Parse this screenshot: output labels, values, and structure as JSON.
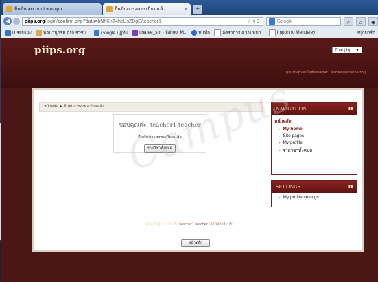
{
  "browser": {
    "tabs": [
      {
        "label": "ยืนยัน account ของคุณ",
        "active": false
      },
      {
        "label": "ยืนยันการลงทะเบียนแล้ว",
        "active": true
      }
    ],
    "new_tab_label": "+",
    "url_host": "piips.org",
    "url_rest": "/login/confirm.php?data=bNhKnT4hcUsZDgE/teacher1",
    "search_placeholder": "Google",
    "bookmarks": [
      {
        "label": "เปรยบมอง",
        "color": "#3b73c4"
      },
      {
        "label": "พจนานุกรม ฉบับราชบั...",
        "color": "#d8a84a"
      },
      {
        "label": "Google ปฏิทิน",
        "color": "#3a78d8"
      },
      {
        "label": "chafee_sm - Yahoo! M...",
        "color": "#7b3fb0"
      },
      {
        "label": "บันทึก",
        "color": "#2d6cc2"
      },
      {
        "label": "อัตราการ ความหมา...",
        "color": "#ffffff"
      },
      {
        "label": "Import to Mendeley",
        "color": "#ffffff"
      }
    ],
    "bookmarks_right": "บุ๊กมาร์ก"
  },
  "site": {
    "logo": "piips.org",
    "language": "Thai (th)",
    "header_login": "คุณเข้าสู่ระบบในชื่อ teacher1 teacher (ออกจากระบบ)"
  },
  "main": {
    "breadcrumb": "หน้าหลัก ► ยืนยันการลงทะเบียนแล้ว",
    "notice_title": "ขอบคุณค่ะ, teacher1 teacher",
    "notice_message": "ยืนยันการลงทะเบียนแล้ว",
    "notice_button": "รายวิชาทั้งหมด"
  },
  "navigation_block": {
    "title": "NAVIGATION",
    "root": "หน้าหลัก",
    "items": [
      "My home",
      "Site pages",
      "My profile",
      "รายวิชาทั้งหมด"
    ]
  },
  "settings_block": {
    "title": "SETTINGS",
    "items": [
      "My profile settings"
    ]
  },
  "footer": {
    "login_prefix": "คุณเข้าสู่ระบบในชื่อ",
    "login_user": "teacher1 teacher",
    "logout": "ออกจากระบบ",
    "home_button": "หน้าหลัก"
  },
  "watermark": "Campus",
  "colors": {
    "brand_dark": "#4b1616",
    "block_header": "#8a2222",
    "logo_text": "#f2e6c6"
  }
}
